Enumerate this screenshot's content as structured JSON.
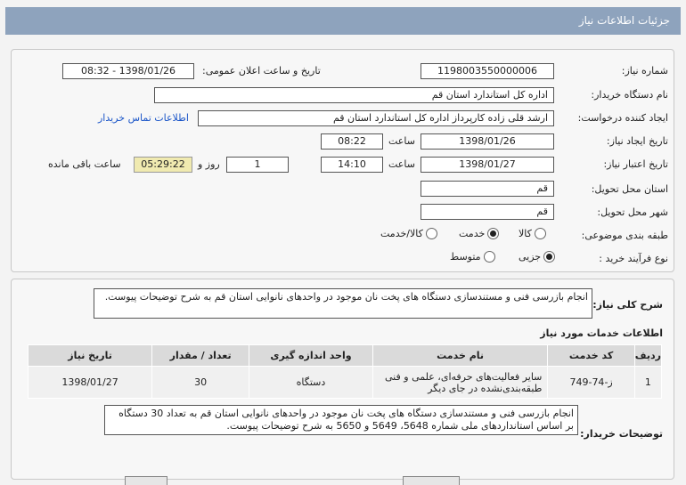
{
  "header": {
    "title": "جزئیات اطلاعات نیاز"
  },
  "form": {
    "need_number_label": "شماره نیاز:",
    "need_number": "1198003550000006",
    "announce_label": "تاریخ و ساعت اعلان عمومی:",
    "announce_value": "1398/01/26 - 08:32",
    "buyer_org_label": "نام دستگاه خریدار:",
    "buyer_org": "اداره کل استاندارد استان قم",
    "requester_label": "ایجاد کننده درخواست:",
    "requester": "ارشد قلی زاده کارپرداز اداره کل استاندارد استان قم",
    "contact_link": "اطلاعات تماس خریدار",
    "created_label": "تاریخ ایجاد نیاز:",
    "created_date": "1398/01/26",
    "time_label": "ساعت",
    "created_time": "08:22",
    "valid_label": "تاریخ اعتبار نیاز:",
    "valid_date": "1398/01/27",
    "valid_time": "14:10",
    "days_value": "1",
    "days_label": "روز و",
    "remaining_time": "05:29:22",
    "remaining_label": "ساعت باقی مانده",
    "province_label": "استان محل تحویل:",
    "province": "قم",
    "city_label": "شهر محل تحویل:",
    "city": "قم",
    "category_label": "طبقه بندی موضوعی:",
    "cat_goods": "کالا",
    "cat_service": "خدمت",
    "cat_goods_service": "کالا/خدمت",
    "process_label": "نوع فرآیند خرید :",
    "proc_partial": "جزیی",
    "proc_medium": "متوسط"
  },
  "details": {
    "summary_label": "شرح کلی نیاز:",
    "summary": "انجام بازرسی فنی و مستندسازی دستگاه های پخت نان موجود در واحدهای نانوایی استان قم به شرح توضیحات پیوست.",
    "services_title": "اطلاعات خدمات مورد نیاز",
    "table_headers": [
      "ردیف",
      "کد خدمت",
      "نام خدمت",
      "واحد اندازه گیری",
      "تعداد / مقدار",
      "تاریخ نیاز"
    ],
    "rows": [
      {
        "row": "1",
        "code": "ز-74-749",
        "name": "سایر فعالیت‌های حرفه‌ای، علمی و فنی طبقه‌بندی‌نشده در جای دیگر",
        "unit": "دستگاه",
        "qty": "30",
        "date": "1398/01/27"
      }
    ],
    "buyer_notes_label": "توضیحات خریدار:",
    "buyer_notes": "انجام بازرسی فنی و مستندسازی دستگاه های پخت نان موجود در واحدهای نانوایی استان قم به تعداد 30 دستگاه بر اساس استانداردهای ملی شماره 5648، 5649 و 5650  به شرح توضیحات پیوست."
  }
}
